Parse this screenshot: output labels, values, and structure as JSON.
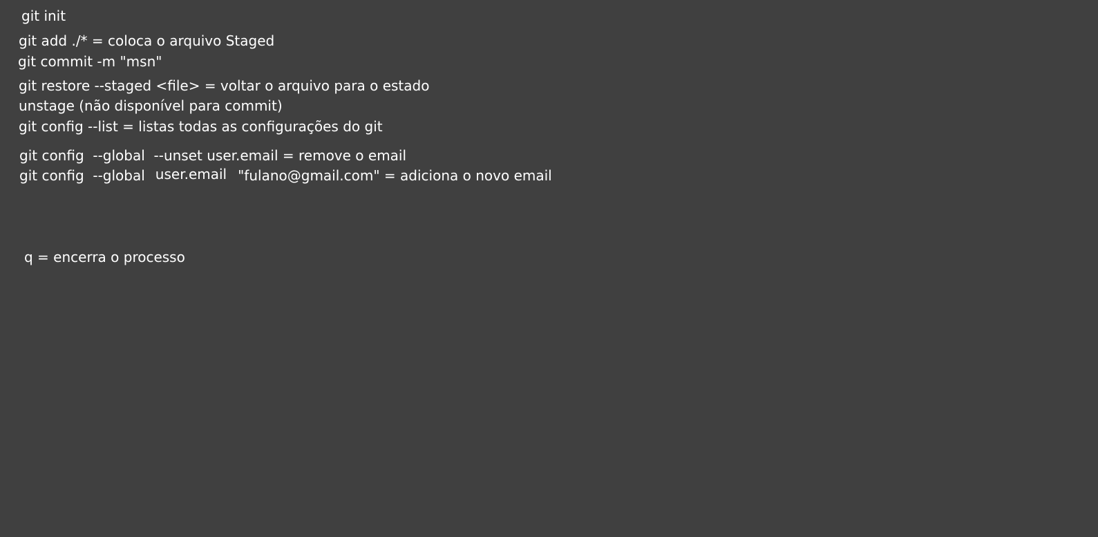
{
  "colors": {
    "background": "#404040",
    "text": "#ffffff"
  },
  "notes": {
    "git_init": "git init",
    "git_add": "git add ./* = coloca o arquivo Staged",
    "git_commit": "git commit -m \"msn\"",
    "git_restore": "git restore --staged <file> = voltar o arquivo para o estado",
    "unstage": "unstage (não disponível para commit)",
    "git_config_list": "git config --list = listas todas as configurações do git",
    "git_config_unset": "git config  --global  --unset user.email = remove o email",
    "git_config_set": {
      "part1": "git config  --global",
      "part2": "user.email",
      "part3": "\"fulano@gmail.com\" = adiciona o novo email"
    },
    "quit": "q = encerra o processo"
  }
}
